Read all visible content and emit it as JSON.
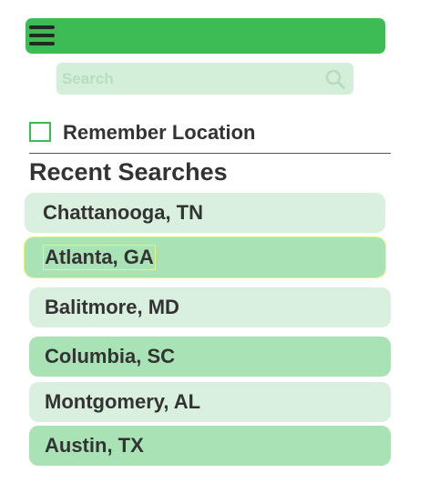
{
  "search": {
    "placeholder": "Search",
    "value": ""
  },
  "remember": {
    "label": "Remember Location",
    "checked": false
  },
  "recent": {
    "title": "Recent Searches",
    "items": [
      {
        "label": "Chattanooga, TN"
      },
      {
        "label": "Atlanta, GA"
      },
      {
        "label": "Balitmore, MD"
      },
      {
        "label": "Columbia, SC"
      },
      {
        "label": "Montgomery, AL"
      },
      {
        "label": "Austin, TX"
      }
    ]
  },
  "colors": {
    "accent": "#3dbb55",
    "item_light": "#d8f0dd",
    "item_medium": "#a8e2b5",
    "search_bg": "#d3efd9",
    "selection_outline": "#e3f37a"
  },
  "icons": {
    "menu": "hamburger-menu-icon",
    "search": "search-icon"
  }
}
